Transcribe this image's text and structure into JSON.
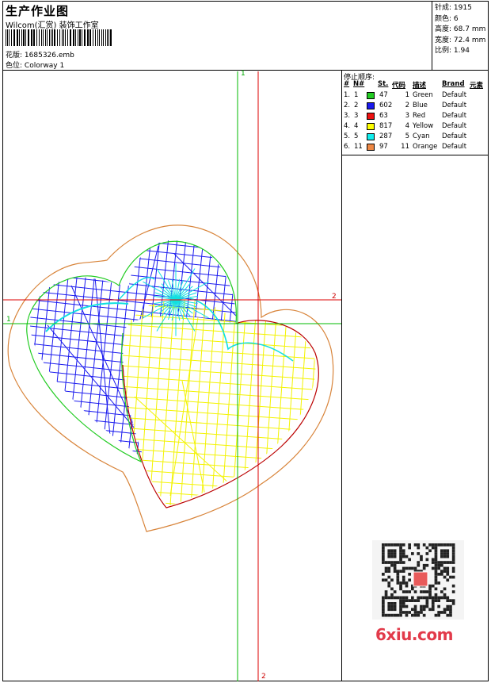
{
  "header": {
    "title": "生产作业图",
    "company": "Wilcom(汇赏) 装饰工作室",
    "design_label": "花版:",
    "design_file": "1685326.emb",
    "colorway_label": "色位:",
    "colorway": "Colorway 1"
  },
  "stats": [
    {
      "label": "针成:",
      "value": "1915"
    },
    {
      "label": "颜色:",
      "value": "6"
    },
    {
      "label": "高度:",
      "value": "68.7 mm"
    },
    {
      "label": "宽度:",
      "value": "72.4 mm"
    },
    {
      "label": "比例:",
      "value": "1.94"
    }
  ],
  "stop_sequence": {
    "title": "停止顺序:",
    "headers": [
      "#",
      "N#",
      "St.",
      "代码",
      "描述",
      "Brand",
      "元素"
    ],
    "rows": [
      {
        "idx": "1.",
        "n": "1",
        "color": "#22cc22",
        "st": "47",
        "code": "1",
        "desc": "Green",
        "brand": "Default"
      },
      {
        "idx": "2.",
        "n": "2",
        "color": "#1a1aee",
        "st": "602",
        "code": "2",
        "desc": "Blue",
        "brand": "Default"
      },
      {
        "idx": "3.",
        "n": "3",
        "color": "#ee1111",
        "st": "63",
        "code": "3",
        "desc": "Red",
        "brand": "Default"
      },
      {
        "idx": "4.",
        "n": "4",
        "color": "#ffff00",
        "st": "817",
        "code": "4",
        "desc": "Yellow",
        "brand": "Default"
      },
      {
        "idx": "5.",
        "n": "5",
        "color": "#11eeee",
        "st": "287",
        "code": "5",
        "desc": "Cyan",
        "brand": "Default"
      },
      {
        "idx": "6.",
        "n": "11",
        "color": "#ee8844",
        "st": "97",
        "code": "11",
        "desc": "Orange",
        "brand": "Default"
      }
    ]
  },
  "axis_labels": {
    "v1_top": "1",
    "h1_left": "1",
    "h2_right": "2",
    "v2_bottom": "2"
  },
  "watermark": "6xiu.com",
  "colors": {
    "green_guide": "#00bb00",
    "red_guide": "#dd0000",
    "orange_outline": "#d8843a",
    "blue_fill": "#1a1aee",
    "yellow_fill": "#f3f300",
    "cyan": "#11e0e0",
    "green_outline": "#22cc22",
    "red_outline": "#bb0000"
  },
  "icons": {
    "qr": "qr-code-icon",
    "barcode": "barcode-icon"
  }
}
